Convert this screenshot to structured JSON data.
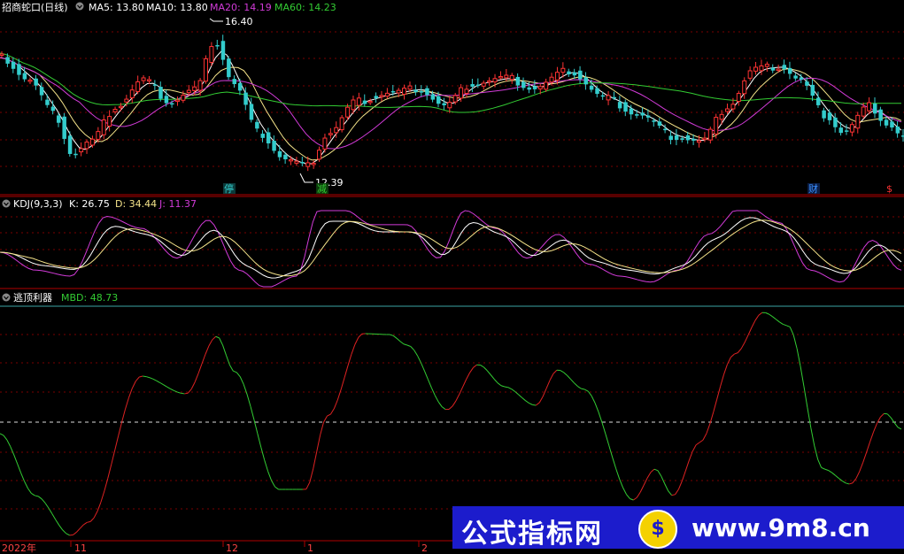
{
  "panel_main": {
    "title": "招商蛇口(日线)",
    "indicators": [
      {
        "label": "MA5: 13.80",
        "color": "#ffffff"
      },
      {
        "label": "MA10: 13.80",
        "color": "#ffffff"
      },
      {
        "label": "MA20: 14.19",
        "color": "#d23bd8"
      },
      {
        "label": "MA60: 14.23",
        "color": "#33cc33"
      }
    ],
    "high_label": "16.40",
    "low_label": "12.39",
    "markers": [
      {
        "text": "停",
        "color": "#33cccc"
      },
      {
        "text": "减",
        "color": "#33cc33"
      },
      {
        "text": "财",
        "color": "#3a8fff"
      },
      {
        "text": "$",
        "color": "#ff3333"
      }
    ]
  },
  "panel_kdj": {
    "title": "KDJ(9,3,3)",
    "values": [
      {
        "label": "K: 26.75",
        "color": "#ffffff"
      },
      {
        "label": "D: 34.44",
        "color": "#f5e48a"
      },
      {
        "label": "J: 11.37",
        "color": "#d23bd8"
      }
    ]
  },
  "panel_mbd": {
    "title": "逃顶利器",
    "values": [
      {
        "label": "MBD: 48.73",
        "color": "#33cc33"
      }
    ]
  },
  "x_axis": {
    "labels": [
      "2022年",
      "11",
      "12",
      "1",
      "2"
    ]
  },
  "watermark": {
    "left_text": "公式指标网",
    "logo_text": "$",
    "right_text": "www.9m8.cn"
  },
  "colors": {
    "up": "#ff3333",
    "down": "#33cccc",
    "grid": "#7a0000",
    "separator": "#b00000",
    "mbd_up": "#dd2222",
    "mbd_down": "#33cc33"
  },
  "chart_data": [
    {
      "type": "candlestick",
      "title": "招商蛇口(日线)",
      "series": [
        {
          "name": "MA5",
          "value": 13.8
        },
        {
          "name": "MA10",
          "value": 13.8
        },
        {
          "name": "MA20",
          "value": 14.19
        },
        {
          "name": "MA60",
          "value": 14.23
        }
      ],
      "annotations": {
        "high": 16.4,
        "low": 12.39
      }
    },
    {
      "type": "line",
      "title": "KDJ(9,3,3)",
      "series": [
        {
          "name": "K",
          "value": 26.75
        },
        {
          "name": "D",
          "value": 34.44
        },
        {
          "name": "J",
          "value": 11.37
        }
      ]
    },
    {
      "type": "line",
      "title": "逃顶利器",
      "series": [
        {
          "name": "MBD",
          "value": 48.73
        }
      ]
    }
  ]
}
